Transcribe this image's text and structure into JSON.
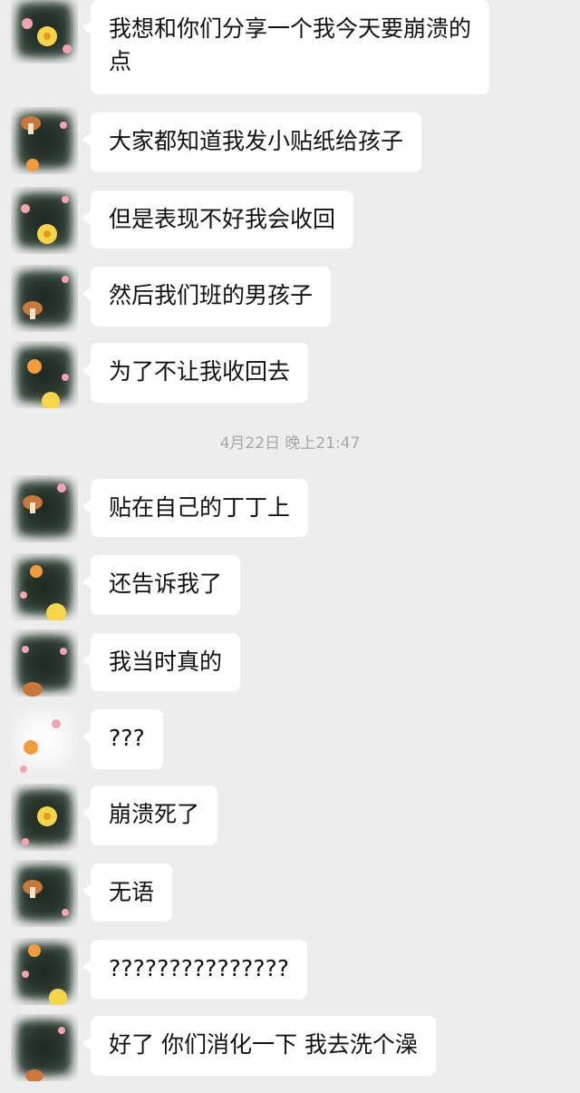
{
  "messages": [
    {
      "text": "我想和你们分享一个我今天要崩溃的点"
    },
    {
      "text": "大家都知道我发小贴纸给孩子"
    },
    {
      "text": "但是表现不好我会收回"
    },
    {
      "text": "然后我们班的男孩子"
    },
    {
      "text": "为了不让我收回去"
    },
    {
      "text": "贴在自己的丁丁上"
    },
    {
      "text": "还告诉我了"
    },
    {
      "text": "我当时真的"
    },
    {
      "text": "???"
    },
    {
      "text": "崩溃死了"
    },
    {
      "text": "无语"
    },
    {
      "text": "???????????????"
    },
    {
      "text": "好了 你们消化一下 我去洗个澡"
    }
  ],
  "timestamp": "4月22日 晚上21:47",
  "colors": {
    "background": "#ededed",
    "bubble": "#ffffff",
    "timestamp": "#a6a6a6"
  },
  "icons": [
    "avatar-flower-frame-icon"
  ]
}
